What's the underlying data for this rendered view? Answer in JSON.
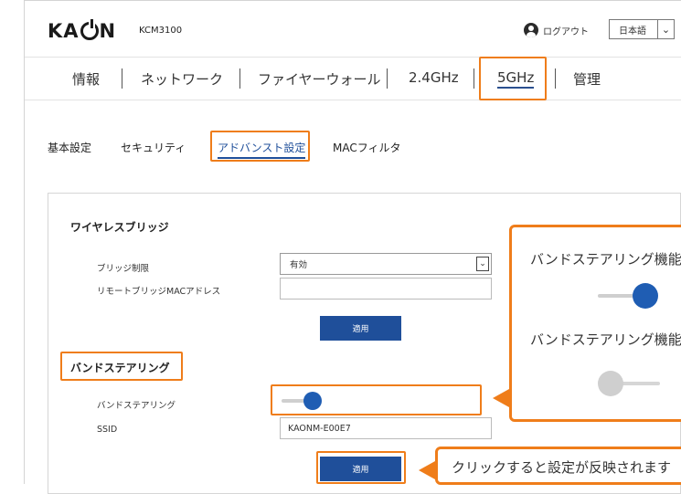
{
  "header": {
    "logo_text_left": "KA",
    "logo_text_right": "N",
    "model": "KCM3100",
    "logout_label": "ログアウト",
    "language": "日本語"
  },
  "nav": {
    "items": [
      "情報",
      "ネットワーク",
      "ファイヤーウォール",
      "2.4GHz",
      "5GHz",
      "管理"
    ],
    "active": "5GHz"
  },
  "subtabs": {
    "items": [
      "基本設定",
      "セキュリティ",
      "アドバンスト設定",
      "MACフィルタ"
    ],
    "active": "アドバンスト設定"
  },
  "wireless_bridge": {
    "title": "ワイヤレスブリッジ",
    "bridge_limit_label": "ブリッジ制限",
    "bridge_limit_value": "有効",
    "remote_mac_label": "リモートブリッジMACアドレス",
    "remote_mac_value": "",
    "apply_label": "適用"
  },
  "band_steering": {
    "title": "バンドステアリング",
    "toggle_label": "バンドステアリング",
    "toggle_on": true,
    "ssid_label": "SSID",
    "ssid_value": "KAONM-E00E7",
    "apply_label": "適用"
  },
  "callout": {
    "line1": "バンドステアリング機能",
    "line2": "バンドステアリング機能",
    "toggle1_on": true,
    "toggle2_on": false
  },
  "tip": {
    "text": "クリックすると設定が反映されます"
  },
  "colors": {
    "accent_orange": "#ef7d1a",
    "brand_blue": "#1f4f9a",
    "toggle_off": "#cfcfcf"
  }
}
